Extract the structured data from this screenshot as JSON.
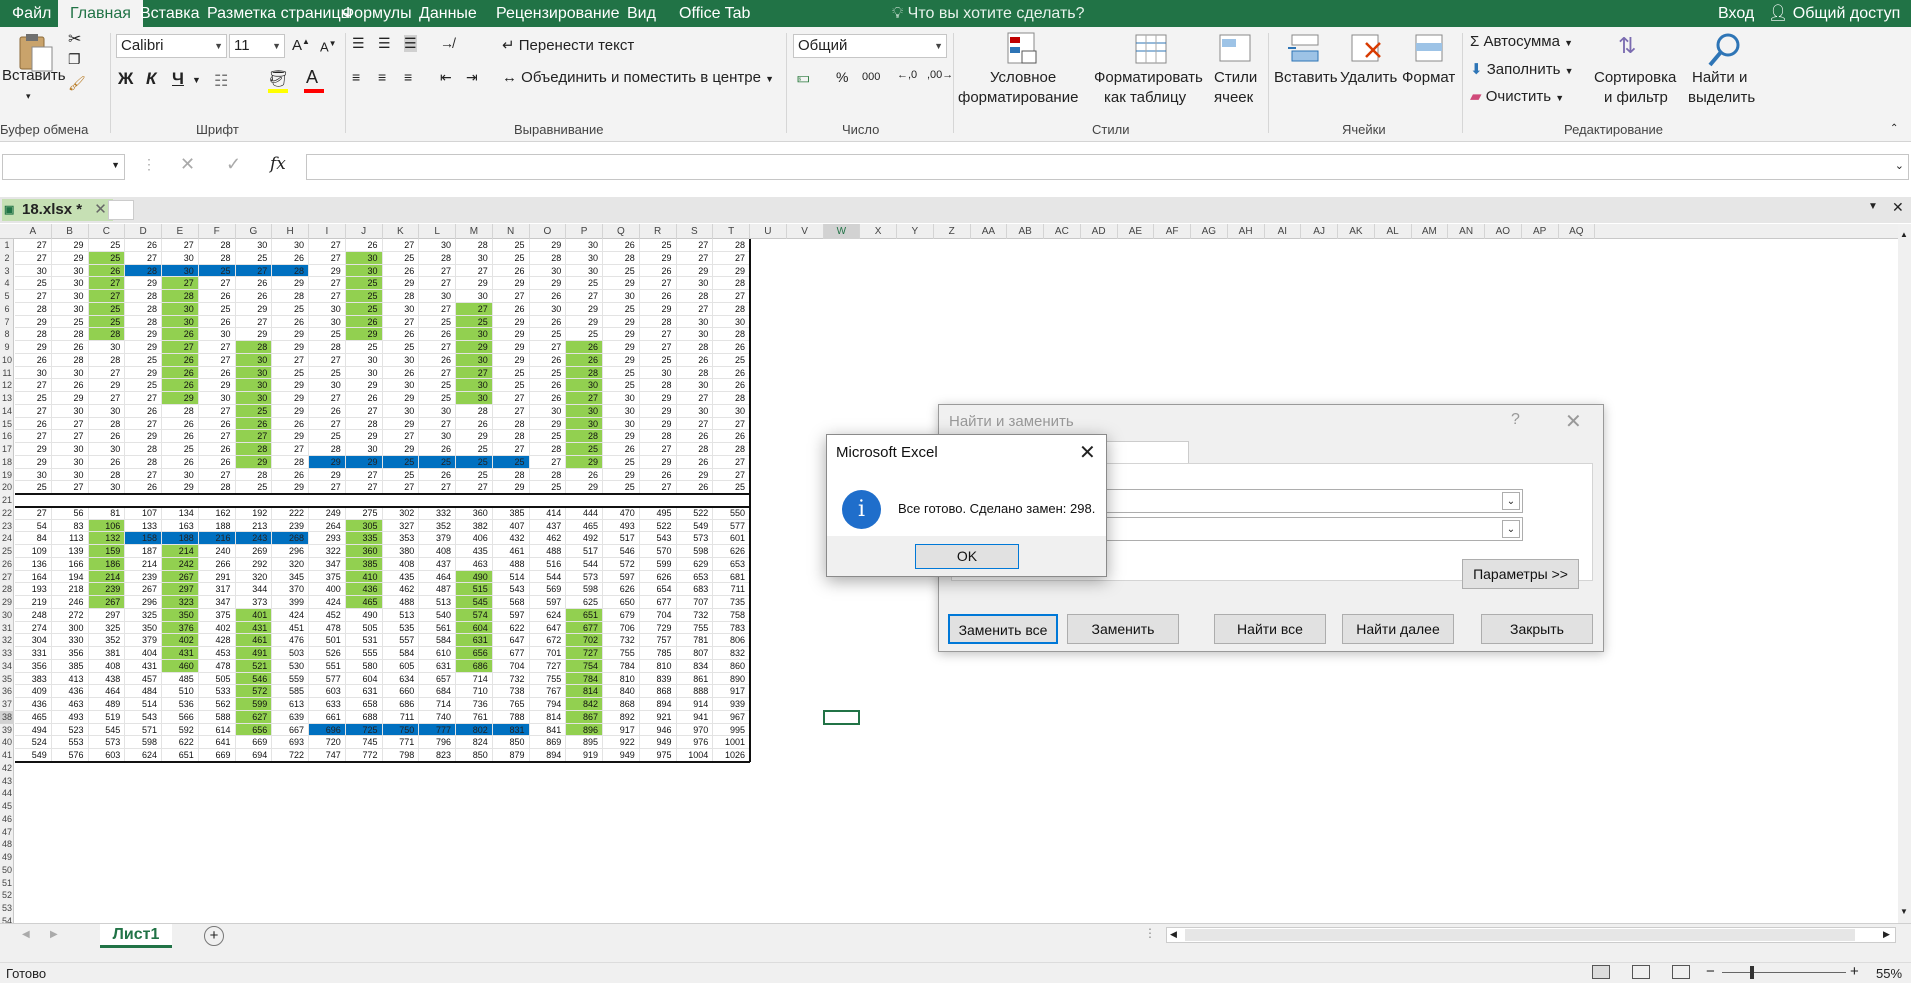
{
  "tabs": [
    "Файл",
    "Главная",
    "Вставка",
    "Разметка страницы",
    "Формулы",
    "Данные",
    "Рецензирование",
    "Вид",
    "Office Tab"
  ],
  "tell_me": "Что вы хотите сделать?",
  "signin": "Вход",
  "share": "Общий доступ",
  "ribbon": {
    "clipboard": {
      "paste": "Вставить",
      "group": "Буфер обмена"
    },
    "font": {
      "name": "Calibri",
      "size": "11",
      "bold": "Ж",
      "italic": "К",
      "underline": "Ч",
      "group": "Шрифт",
      "color_fill": "#ffff00",
      "color_font": "#ff0000"
    },
    "alignment": {
      "wrap": "Перенести текст",
      "merge": "Объединить и поместить в центре",
      "group": "Выравнивание"
    },
    "number": {
      "format": "Общий",
      "thousands": "000",
      "group": "Число"
    },
    "styles": {
      "cond_1": "Условное",
      "cond_2": "форматирование",
      "table_1": "Форматировать",
      "table_2": "как таблицу",
      "cell_1": "Стили",
      "cell_2": "ячеек",
      "group": "Стили"
    },
    "cells": {
      "insert": "Вставить",
      "delete": "Удалить",
      "format": "Формат",
      "group": "Ячейки"
    },
    "editing": {
      "autosum": "Автосумма",
      "fill": "Заполнить",
      "clear": "Очистить",
      "sort_1": "Сортировка",
      "sort_2": "и фильтр",
      "find_1": "Найти и",
      "find_2": "выделить",
      "group": "Редактирование"
    }
  },
  "workbook_tab": "18.xlsx *",
  "columns": [
    "A",
    "B",
    "C",
    "D",
    "E",
    "F",
    "G",
    "H",
    "I",
    "J",
    "K",
    "L",
    "M",
    "N",
    "O",
    "P",
    "Q",
    "R",
    "S",
    "T",
    "U",
    "V",
    "W",
    "X",
    "Y",
    "Z",
    "AA",
    "AB",
    "AC",
    "AD",
    "AE",
    "AF",
    "AG",
    "AH",
    "AI",
    "AJ",
    "AK",
    "AL",
    "AM",
    "AN",
    "AO",
    "AP",
    "AQ"
  ],
  "rows_top": [
    [
      27,
      29,
      25,
      26,
      27,
      28,
      30,
      30,
      27,
      26,
      27,
      30,
      28,
      25,
      29,
      30,
      26,
      25,
      27,
      28
    ],
    [
      27,
      29,
      25,
      27,
      30,
      28,
      25,
      26,
      27,
      30,
      25,
      28,
      30,
      25,
      28,
      30,
      28,
      29,
      27,
      27
    ],
    [
      30,
      30,
      26,
      28,
      30,
      25,
      27,
      28,
      29,
      30,
      26,
      27,
      27,
      26,
      30,
      30,
      25,
      26,
      29,
      29
    ],
    [
      25,
      30,
      27,
      29,
      27,
      27,
      26,
      29,
      27,
      25,
      29,
      27,
      29,
      29,
      29,
      25,
      29,
      27,
      30,
      28
    ],
    [
      27,
      30,
      27,
      28,
      28,
      26,
      26,
      28,
      27,
      25,
      28,
      30,
      30,
      27,
      26,
      27,
      30,
      26,
      28,
      27
    ],
    [
      28,
      30,
      25,
      28,
      30,
      25,
      29,
      25,
      30,
      25,
      30,
      27,
      27,
      26,
      30,
      29,
      25,
      29,
      27,
      28
    ],
    [
      29,
      25,
      25,
      28,
      30,
      26,
      27,
      26,
      30,
      26,
      27,
      25,
      25,
      29,
      26,
      29,
      29,
      28,
      30,
      30
    ],
    [
      28,
      28,
      28,
      29,
      26,
      30,
      29,
      29,
      25,
      29,
      26,
      26,
      30,
      29,
      25,
      25,
      29,
      27,
      30,
      28
    ],
    [
      29,
      26,
      30,
      29,
      27,
      27,
      28,
      29,
      28,
      25,
      25,
      27,
      29,
      29,
      27,
      26,
      29,
      27,
      28,
      26
    ],
    [
      26,
      28,
      28,
      25,
      26,
      27,
      30,
      27,
      27,
      30,
      30,
      26,
      30,
      29,
      26,
      26,
      29,
      25,
      26,
      25
    ],
    [
      30,
      30,
      27,
      29,
      26,
      26,
      30,
      25,
      25,
      30,
      26,
      27,
      27,
      25,
      25,
      28,
      25,
      30,
      28,
      26
    ],
    [
      27,
      26,
      29,
      25,
      26,
      29,
      30,
      29,
      30,
      29,
      30,
      25,
      30,
      25,
      26,
      30,
      25,
      28,
      30,
      26
    ],
    [
      25,
      29,
      27,
      27,
      29,
      30,
      30,
      29,
      27,
      26,
      29,
      25,
      30,
      27,
      26,
      27,
      30,
      29,
      27,
      28
    ],
    [
      27,
      30,
      30,
      26,
      28,
      27,
      25,
      29,
      26,
      27,
      30,
      30,
      28,
      27,
      30,
      30,
      30,
      29,
      30,
      30
    ],
    [
      26,
      27,
      28,
      27,
      26,
      26,
      26,
      26,
      27,
      28,
      29,
      27,
      26,
      28,
      29,
      30,
      30,
      29,
      27,
      27
    ],
    [
      27,
      27,
      26,
      29,
      26,
      27,
      27,
      29,
      25,
      29,
      27,
      30,
      29,
      28,
      25,
      28,
      29,
      28,
      26,
      26
    ],
    [
      29,
      30,
      30,
      28,
      25,
      26,
      28,
      27,
      28,
      30,
      29,
      26,
      25,
      27,
      28,
      25,
      26,
      27,
      28,
      28
    ],
    [
      29,
      30,
      26,
      28,
      26,
      26,
      29,
      28,
      29,
      29,
      25,
      25,
      25,
      25,
      27,
      29,
      25,
      29,
      26,
      27
    ],
    [
      30,
      30,
      28,
      27,
      30,
      27,
      28,
      26,
      29,
      27,
      25,
      26,
      25,
      28,
      28,
      26,
      29,
      26,
      29,
      27
    ],
    [
      25,
      27,
      30,
      26,
      29,
      28,
      25,
      29,
      27,
      27,
      27,
      27,
      27,
      29,
      25,
      29,
      25,
      27,
      26,
      25
    ]
  ],
  "rows_bottom": [
    [
      27,
      56,
      81,
      107,
      134,
      162,
      192,
      222,
      249,
      275,
      302,
      332,
      360,
      385,
      414,
      444,
      470,
      495,
      522,
      550
    ],
    [
      54,
      83,
      106,
      133,
      163,
      188,
      213,
      239,
      264,
      305,
      327,
      352,
      382,
      407,
      437,
      465,
      493,
      522,
      549,
      577
    ],
    [
      84,
      113,
      132,
      158,
      188,
      216,
      243,
      268,
      293,
      335,
      353,
      379,
      406,
      432,
      462,
      492,
      517,
      543,
      573,
      601
    ],
    [
      109,
      139,
      159,
      187,
      214,
      240,
      269,
      296,
      322,
      360,
      380,
      408,
      435,
      461,
      488,
      517,
      546,
      570,
      598,
      626
    ],
    [
      136,
      166,
      186,
      214,
      242,
      266,
      292,
      320,
      347,
      385,
      408,
      437,
      463,
      488,
      516,
      544,
      572,
      599,
      629,
      653
    ],
    [
      164,
      194,
      214,
      239,
      267,
      291,
      320,
      345,
      375,
      410,
      435,
      464,
      490,
      514,
      544,
      573,
      597,
      626,
      653,
      681
    ],
    [
      193,
      218,
      239,
      267,
      297,
      317,
      344,
      370,
      400,
      436,
      462,
      487,
      515,
      543,
      569,
      598,
      626,
      654,
      683,
      711
    ],
    [
      219,
      246,
      267,
      296,
      323,
      347,
      373,
      399,
      424,
      465,
      488,
      513,
      545,
      568,
      597,
      625,
      650,
      677,
      707,
      735
    ],
    [
      248,
      272,
      297,
      325,
      350,
      375,
      401,
      424,
      452,
      490,
      513,
      540,
      574,
      597,
      624,
      651,
      679,
      704,
      732,
      758
    ],
    [
      274,
      300,
      325,
      350,
      376,
      402,
      431,
      451,
      478,
      505,
      535,
      561,
      604,
      622,
      647,
      677,
      706,
      729,
      755,
      783
    ],
    [
      304,
      330,
      352,
      379,
      402,
      428,
      461,
      476,
      501,
      531,
      557,
      584,
      631,
      647,
      672,
      702,
      732,
      757,
      781,
      806
    ],
    [
      331,
      356,
      381,
      404,
      431,
      453,
      491,
      503,
      526,
      555,
      584,
      610,
      656,
      677,
      701,
      727,
      755,
      785,
      807,
      832
    ],
    [
      356,
      385,
      408,
      431,
      460,
      478,
      521,
      530,
      551,
      580,
      605,
      631,
      686,
      704,
      727,
      754,
      784,
      810,
      834,
      860
    ],
    [
      383,
      413,
      438,
      457,
      485,
      505,
      546,
      559,
      577,
      604,
      634,
      657,
      714,
      732,
      755,
      784,
      810,
      839,
      861,
      890
    ],
    [
      409,
      436,
      464,
      484,
      510,
      533,
      572,
      585,
      603,
      631,
      660,
      684,
      710,
      738,
      767,
      814,
      840,
      868,
      888,
      917
    ],
    [
      436,
      463,
      489,
      514,
      536,
      562,
      599,
      613,
      633,
      658,
      686,
      714,
      736,
      765,
      794,
      842,
      868,
      894,
      914,
      939
    ],
    [
      465,
      493,
      519,
      543,
      566,
      588,
      627,
      639,
      661,
      688,
      711,
      740,
      761,
      788,
      814,
      867,
      892,
      921,
      941,
      967
    ],
    [
      494,
      523,
      545,
      571,
      592,
      614,
      656,
      667,
      696,
      725,
      750,
      777,
      802,
      831,
      841,
      896,
      917,
      946,
      970,
      995
    ],
    [
      524,
      553,
      573,
      598,
      622,
      641,
      669,
      693,
      720,
      745,
      771,
      796,
      824,
      850,
      869,
      895,
      922,
      949,
      976,
      1001
    ],
    [
      549,
      576,
      603,
      624,
      651,
      669,
      694,
      722,
      747,
      772,
      798,
      823,
      850,
      879,
      894,
      919,
      949,
      975,
      1004,
      1026
    ]
  ],
  "sheet_tab": "Лист1",
  "status": {
    "ready": "Готово",
    "zoom": "55%"
  },
  "find_replace": {
    "title": "Найти и заменить",
    "help": "?",
    "options_btn": "Параметры >>",
    "replace_all": "Заменить все",
    "replace": "Заменить",
    "find_all": "Найти все",
    "find_next": "Найти далее",
    "close": "Закрыть"
  },
  "msgbox": {
    "title": "Microsoft Excel",
    "message": "Все готово. Сделано замен: 298.",
    "ok": "OK",
    "icon_color": "#1f6ecb"
  },
  "colors": {
    "accent": "#217346",
    "green_fill": "#92d050",
    "blue_fill": "#0070c0"
  }
}
